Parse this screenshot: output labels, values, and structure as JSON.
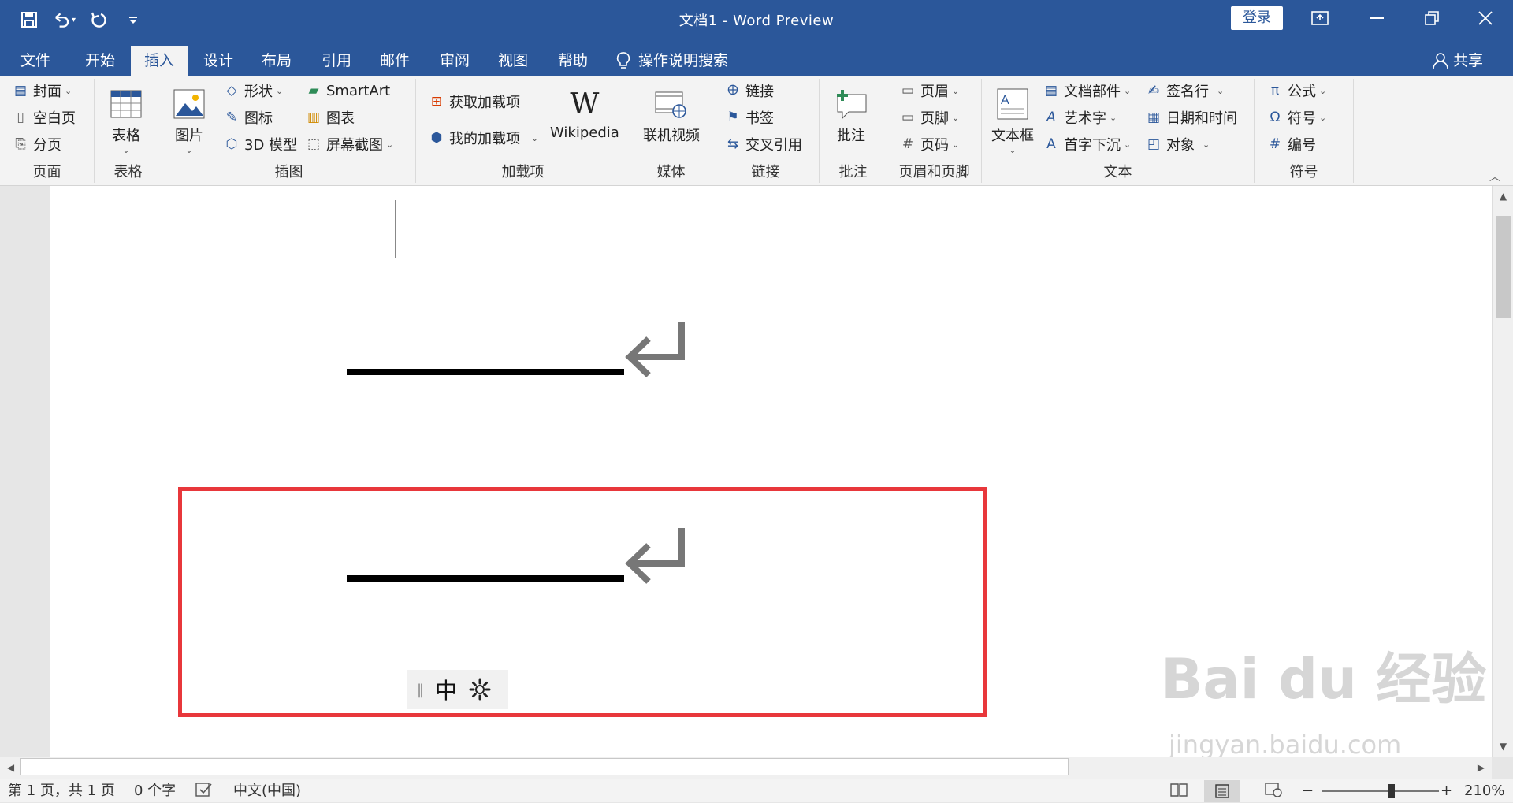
{
  "titlebar": {
    "title": "文档1  -  Word Preview",
    "login": "登录",
    "qat_icons": [
      "save-icon",
      "undo-icon",
      "redo-icon",
      "customize-icon"
    ]
  },
  "tabs": [
    {
      "label": "文件"
    },
    {
      "label": "开始"
    },
    {
      "label": "插入",
      "active": true
    },
    {
      "label": "设计"
    },
    {
      "label": "布局"
    },
    {
      "label": "引用"
    },
    {
      "label": "邮件"
    },
    {
      "label": "审阅"
    },
    {
      "label": "视图"
    },
    {
      "label": "帮助"
    }
  ],
  "tell_me": "操作说明搜索",
  "share": "共享",
  "ribbon": {
    "pages": {
      "label": "页面",
      "cover": "封面",
      "blank": "空白页",
      "break": "分页"
    },
    "tables": {
      "label": "表格",
      "table": "表格"
    },
    "illustrations": {
      "label": "插图",
      "pictures": "图片",
      "shapes": "形状",
      "icons": "图标",
      "model3d": "3D 模型",
      "smartart": "SmartArt",
      "chart": "图表",
      "screenshot": "屏幕截图"
    },
    "addins": {
      "label": "加载项",
      "get": "获取加载项",
      "my": "我的加载项",
      "wiki": "Wikipedia"
    },
    "media": {
      "label": "媒体",
      "video": "联机视频"
    },
    "links": {
      "label": "链接",
      "link": "链接",
      "bookmark": "书签",
      "xref": "交叉引用"
    },
    "comments": {
      "label": "批注",
      "comment": "批注"
    },
    "headerfooter": {
      "label": "页眉和页脚",
      "header": "页眉",
      "footer": "页脚",
      "pagenum": "页码"
    },
    "text": {
      "label": "文本",
      "textbox": "文本框",
      "quickparts": "文档部件",
      "wordart": "艺术字",
      "dropcap": "首字下沉",
      "sigline": "签名行",
      "datetime": "日期和时间",
      "object": "对象"
    },
    "symbols": {
      "label": "符号",
      "equation": "公式",
      "symbol": "符号",
      "number": "编号"
    }
  },
  "document": {
    "ime_char": "中",
    "paragraph_mark": "↵"
  },
  "status": {
    "page": "第 1 页，共 1 页",
    "words": "0 个字",
    "lang": "中文(中国)",
    "zoom": "210%"
  },
  "watermark": {
    "brand": "Bai du 经验",
    "url": "jingyan.baidu.com"
  }
}
